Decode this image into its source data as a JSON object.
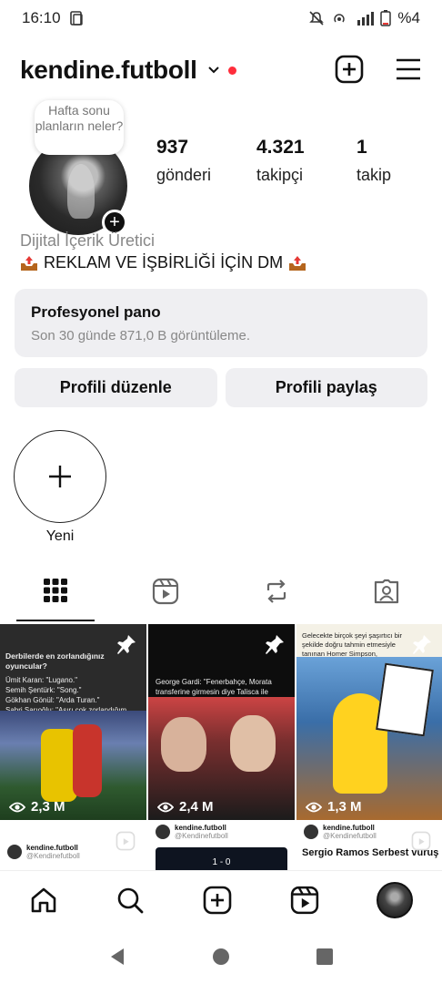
{
  "status_bar": {
    "time": "16:10",
    "battery": "%4",
    "network": "4G"
  },
  "header": {
    "username": "kendine.futboll"
  },
  "profile": {
    "note": "Hafta sonu planların neler?",
    "stats": [
      {
        "value": "937",
        "label": "gönderi"
      },
      {
        "value": "4.321",
        "label": "takipçi"
      },
      {
        "value": "1",
        "label": "takip"
      }
    ],
    "category": "Dijital İçerik Üretici",
    "bio": "REKLAM VE İŞBİRLİĞİ İÇİN DM"
  },
  "pro_dashboard": {
    "title": "Profesyonel pano",
    "subtitle": "Son 30 günde 871,0 B görüntüleme."
  },
  "buttons": {
    "edit": "Profili düzenle",
    "share": "Profili paylaş"
  },
  "highlight": {
    "label": "Yeni"
  },
  "tabs": [
    "posts-grid",
    "reels",
    "reposts",
    "tagged"
  ],
  "posts": [
    {
      "views": "2,3 M",
      "pinned": true,
      "caption": "Derbilerde en zorlandığınız oyuncular?",
      "lines": [
        "Ümit Karan: \"Lugano.\"",
        "Semih Şentürk: \"Song.\"",
        "Gökhan Gönül: \"Arda Turan.\"",
        "Sabri Sarıoğlu: \"Aşırı çok zorlandığım olmadı.\""
      ]
    },
    {
      "views": "2,4 M",
      "pinned": true,
      "caption": "George Gardi: \"Fenerbahçe, Morata transferine girmesin diye Talisca ile ilgileniyormuş gibi yaptım.\""
    },
    {
      "views": "1,3 M",
      "pinned": true,
      "caption": "Gelecekte birçok şeyi şaşırtıcı bir şekilde doğru tahmin etmesiyle tanınan Homer Simpson, Şampiyonlar Ligi kupasını kazanacak takımı açıkladı.."
    },
    {
      "account": "kendine.futboll",
      "handle": "@Kendinefutboll"
    },
    {
      "account": "kendine.futboll",
      "handle": "@Kendinefutboll",
      "score": "1 - 0"
    },
    {
      "account": "kendine.futboll",
      "handle": "@Kendinefutboll",
      "headline": "Sergio Ramos Serbest vuruş"
    }
  ],
  "bottom_nav": [
    "home",
    "search",
    "create",
    "reels",
    "profile"
  ],
  "colors": {
    "accent_red": "#ff2d3b",
    "card_bg": "#efeff2"
  }
}
